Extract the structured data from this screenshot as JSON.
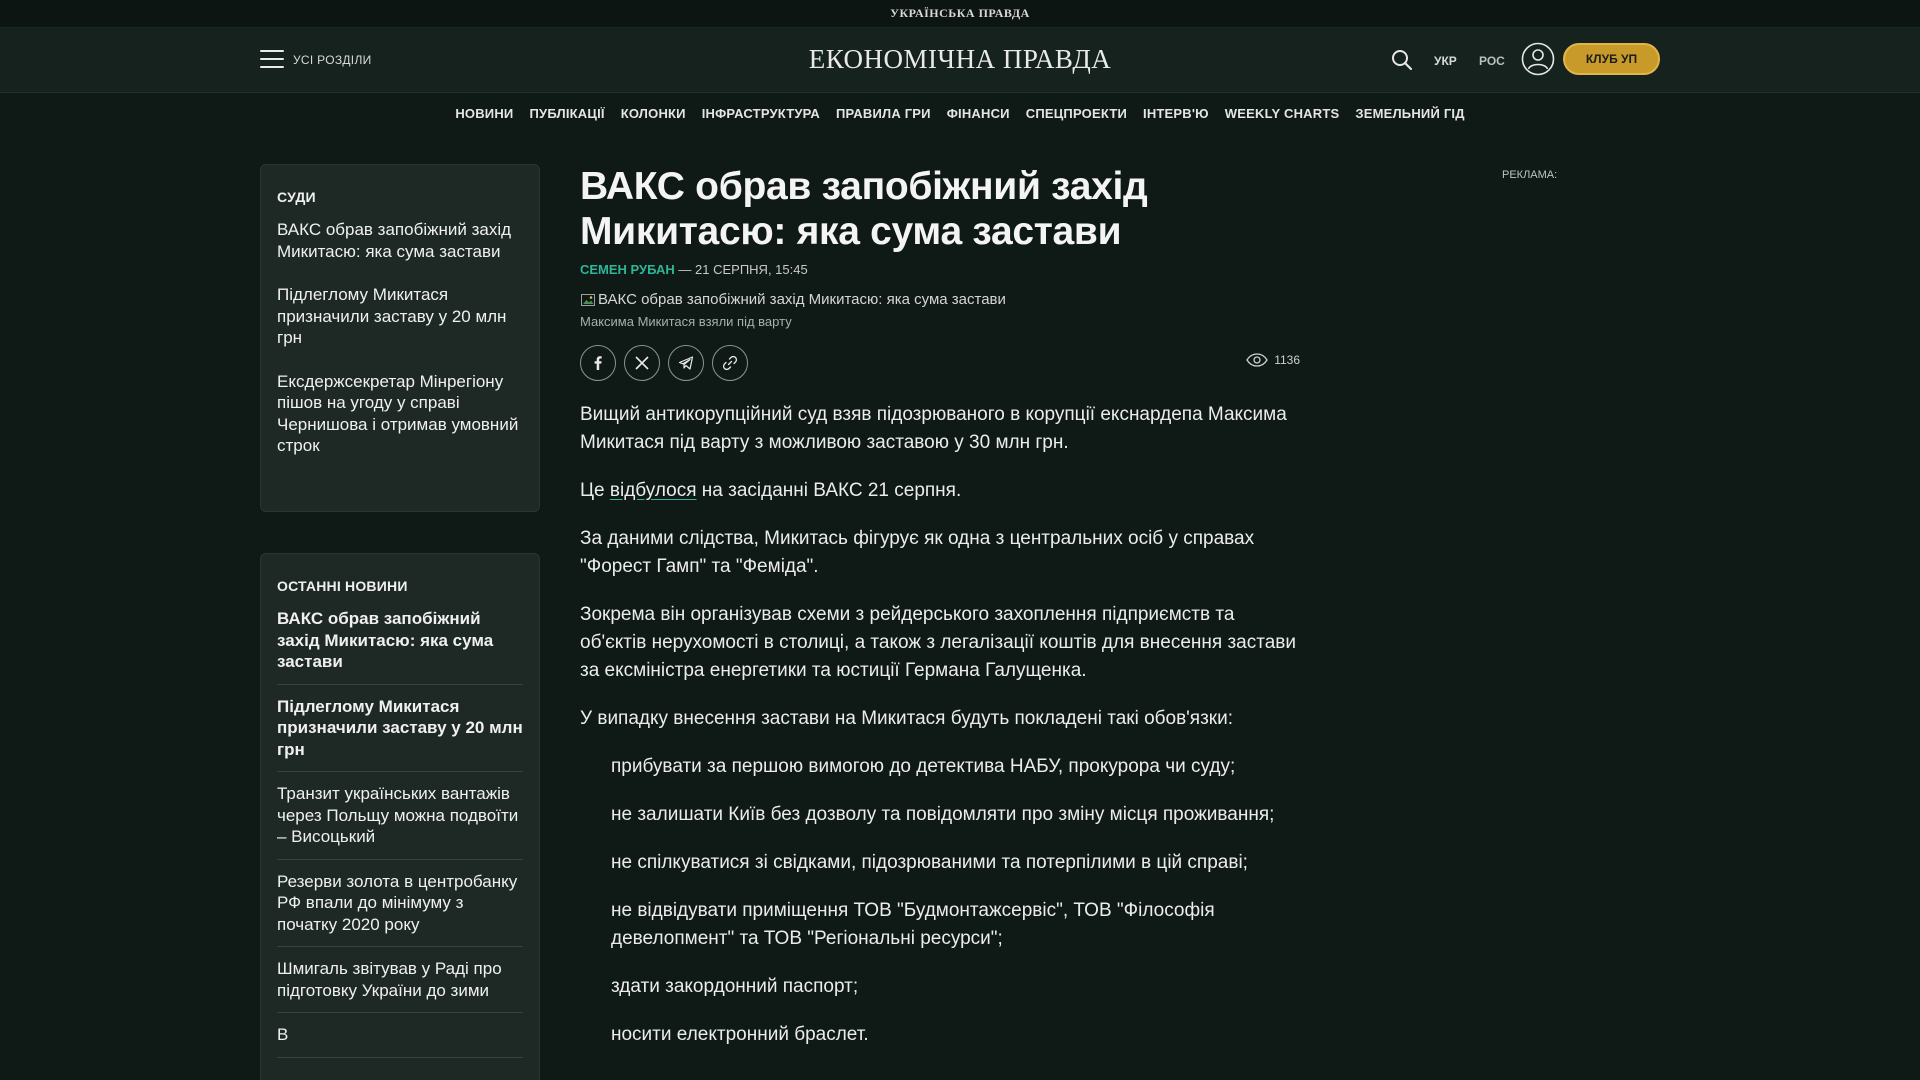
{
  "topstrip": {
    "brand": "УКРАЇНСЬКА ПРАВДА"
  },
  "header": {
    "sections_label": "УСІ РОЗДІЛИ",
    "logo": "ЕКОНОМІЧНА ПРАВДА",
    "lang_ukr": "УКР",
    "lang_ros": "РОС",
    "club_button": "КЛУБ УП",
    "icons": [
      "menu-icon",
      "search-icon",
      "user-icon"
    ]
  },
  "nav": [
    "НОВИНИ",
    "ПУБЛІКАЦІЇ",
    "КОЛОНКИ",
    "ІНФРАСТРУКТУРА",
    "ПРАВИЛА ГРИ",
    "ФІНАНСИ",
    "СПЕЦПРОЕКТИ",
    "ІНТЕРВ'Ю",
    "WEEKLY CHARTS",
    "ЗЕМЕЛЬНИЙ ГІД"
  ],
  "topic_box": {
    "title": "СУДИ",
    "items": [
      "ВАКС обрав запобіжний захід Микитасю: яка сума застави",
      "Підлеглому Микитася призначили заставу у 20 млн грн",
      "Ексдержсекретар Мінрегіону пішов на угоду у справі Чернишова і отримав умовний строк"
    ]
  },
  "latest_news": {
    "title": "ОСТАННІ НОВИНИ",
    "items": [
      {
        "text": "ВАКС обрав запобіжний захід Микитасю: яка сума застави",
        "bold": true
      },
      {
        "text": "Підлеглому Микитася призначили заставу у 20 млн грн",
        "bold": true
      },
      {
        "text": "Транзит українських вантажів через Польщу можна подвоїти – Висоцький",
        "bold": false
      },
      {
        "text": "Резерви золота в центробанку РФ впали до мінімуму з початку 2020 року",
        "bold": false
      },
      {
        "text": "Шмигаль звітував у Раді про підготовку України до зими",
        "bold": false
      },
      {
        "text": "В",
        "bold": false
      }
    ]
  },
  "article": {
    "title": "ВАКС обрав запобіжний захід Микитасю: яка сума застави",
    "author": "СЕМЕН РУБАН",
    "byline_sep": " — ",
    "date": "21 СЕРПНЯ, 15:45",
    "image_alt": "ВАКС обрав запобіжний захід Микитасю: яка сума застави",
    "caption": "Максима Микитася взяли під варту",
    "share_icons": [
      "facebook-icon",
      "x-twitter-icon",
      "telegram-icon",
      "copy-link-icon"
    ],
    "views": "1136",
    "p1": "Вищий антикорупційний суд взяв підозрюваного в корупції екснардепа Максима Микитася під варту з можливою заставою у 30 млн грн.",
    "p2_before": "Це ",
    "p2_link": "відбулося",
    "p2_after": " на засіданні ВАКС 21 серпня.",
    "p3": "За даними слідства, Микитась фігурує як одна з центральних осіб у справах \"Форест Гамп\" та \"Феміда\".",
    "p4": "Зокрема він організував схеми з рейдерського захоплення підприємств та об'єктів нерухомості в столиці, а також з легалізації коштів для внесення застави за ексміністра енергетики та юстиції Германа Галущенка.",
    "p5": "У випадку внесення застави на Микитася будуть покладені такі обов'язки:",
    "obligations": [
      "прибувати за першою вимогою до детектива НАБУ, прокурора чи суду;",
      "не залишати Київ без дозволу та повідомляти про зміну місця проживання;",
      "не спілкуватися зі свідками, підозрюваними та потерпілими в цій справі;",
      "не відвідувати приміщення ТОВ \"Будмонтажсервіс\", ТОВ \"Філософія девелопмент\" та ТОВ \"Регіональні ресурси\";",
      "здати закордонний паспорт;",
      "носити електронний браслет."
    ]
  },
  "ad": {
    "label": "РЕКЛАМА:"
  },
  "colors": {
    "background": "#0f1a16",
    "accent": "#2fb598",
    "club": "#c79a2a"
  }
}
